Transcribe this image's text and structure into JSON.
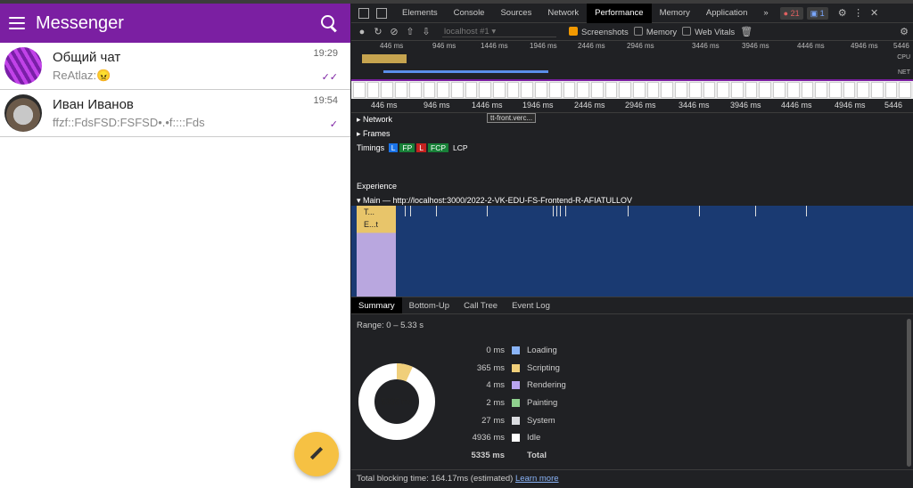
{
  "messenger": {
    "title": "Messenger",
    "chats": [
      {
        "name": "Общий чат",
        "last_message": "ReAtlaz:😠",
        "time": "19:29",
        "status": "✓✓"
      },
      {
        "name": "Иван Иванов",
        "last_message": "ffzf::FdsFSD:FSFSD•.•f::::Fds",
        "time": "19:54",
        "status": "✓"
      }
    ],
    "fab_icon": "pencil-icon"
  },
  "devtools": {
    "tabs": [
      "Elements",
      "Console",
      "Sources",
      "Network",
      "Performance",
      "Memory",
      "Application"
    ],
    "more_tabs": "»",
    "errors_count": "21",
    "messages_count": "1",
    "toolbar": {
      "url": "localhost #1",
      "screenshots_label": "Screenshots",
      "memory_label": "Memory",
      "web_vitals_label": "Web Vitals"
    },
    "overview_ticks": [
      "446 ms",
      "946 ms",
      "1446 ms",
      "1946 ms",
      "2446 ms",
      "2946 ms",
      "3446 ms",
      "3946 ms",
      "4446 ms",
      "4946 ms",
      "5446"
    ],
    "overview_labels": {
      "cpu": "CPU",
      "net": "NET"
    },
    "ruler_ticks": [
      "446 ms",
      "946 ms",
      "1446 ms",
      "1946 ms",
      "2446 ms",
      "2946 ms",
      "3446 ms",
      "3946 ms",
      "4446 ms",
      "4946 ms",
      "5446"
    ],
    "tracks": {
      "network": "Network",
      "network_tip": "tt-front.verc...",
      "frames": "Frames",
      "timings": "Timings",
      "timing_markers": [
        {
          "label": "L",
          "color": "#1a73e8"
        },
        {
          "label": "FP",
          "color": "#188038"
        },
        {
          "label": "L",
          "color": "#c5221f"
        },
        {
          "label": "FCP",
          "color": "#188038"
        },
        {
          "label": "LCP",
          "color": "#202124"
        }
      ],
      "experience": "Experience",
      "main": "Main — http://localhost:3000/2022-2-VK-EDU-FS-Frontend-R-AFIATULLOV",
      "flame_labels": [
        "T...",
        "E...t"
      ]
    },
    "bottom_tabs": [
      "Summary",
      "Bottom-Up",
      "Call Tree",
      "Event Log"
    ],
    "summary": {
      "range": "Range: 0 – 5.33 s",
      "total_center": "5335 ms",
      "rows": [
        {
          "value": "0 ms",
          "label": "Loading",
          "color": "#8ab4f8"
        },
        {
          "value": "365 ms",
          "label": "Scripting",
          "color": "#f0cf7a"
        },
        {
          "value": "4 ms",
          "label": "Rendering",
          "color": "#b8a4f0"
        },
        {
          "value": "2 ms",
          "label": "Painting",
          "color": "#8fd18e"
        },
        {
          "value": "27 ms",
          "label": "System",
          "color": "#dadce0"
        },
        {
          "value": "4936 ms",
          "label": "Idle",
          "color": "#ffffff"
        }
      ],
      "total": {
        "value": "5335 ms",
        "label": "Total"
      }
    },
    "footer": {
      "text": "Total blocking time: 164.17ms (estimated)",
      "link": "Learn more"
    }
  }
}
